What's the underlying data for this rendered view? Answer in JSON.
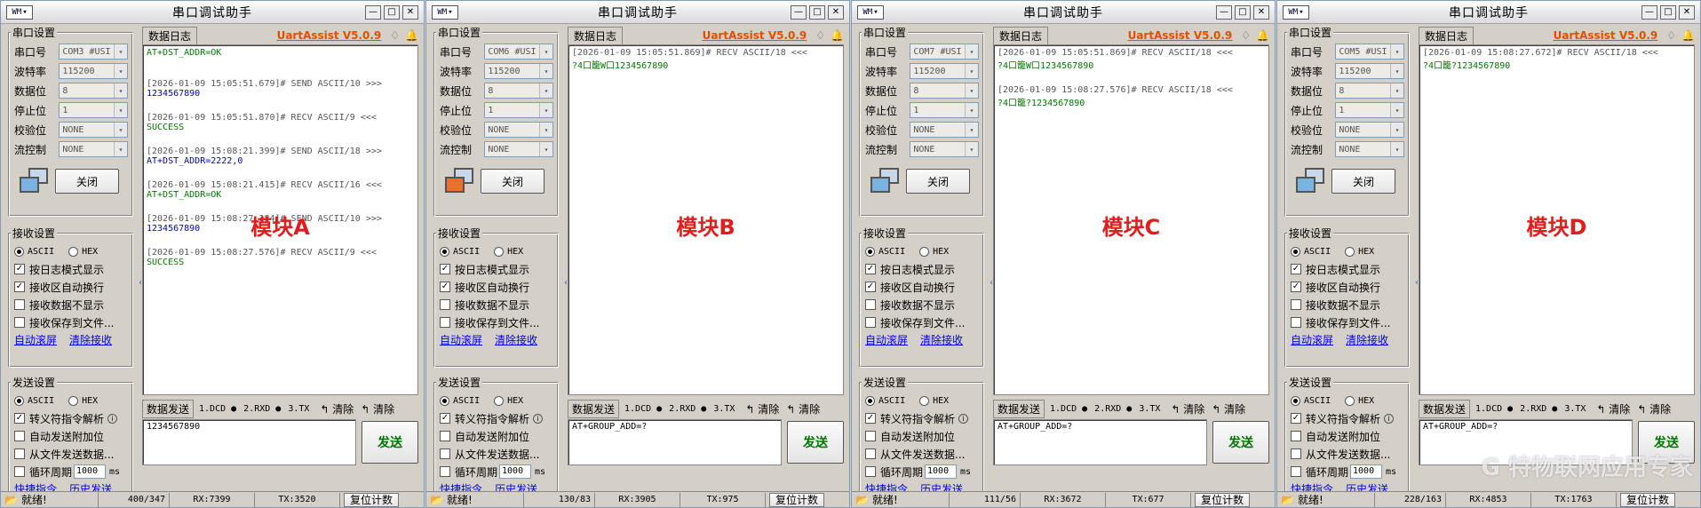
{
  "common": {
    "title": "串口调试助手",
    "brand": "UartAssist V5.0.9",
    "app_icon": "WM",
    "min_label": "—",
    "max_label": "□",
    "close_label": "✕",
    "port_group": "串口设置",
    "port_label": "串口号",
    "baud_label": "波特率",
    "databits_label": "数据位",
    "stopbits_label": "停止位",
    "parity_label": "校验位",
    "flow_label": "流控制",
    "baud_value": "115200",
    "databits_value": "8",
    "stopbits_value": "1",
    "parity_value": "NONE",
    "flow_value": "NONE",
    "close_button": "关闭",
    "recv_group": "接收设置",
    "ascii": "ASCII",
    "hex": "HEX",
    "recv_opt_log": "按日志模式显示",
    "recv_opt_wrap": "接收区自动换行",
    "recv_opt_hide": "接收数据不显示",
    "recv_opt_save": "接收保存到文件...",
    "auto_scroll": "自动滚屏",
    "clear_recv": "清除接收",
    "send_group": "发送设置",
    "send_opt_escape": "转义符指令解析",
    "send_opt_append": "自动发送附加位",
    "send_opt_file": "从文件发送数据...",
    "send_opt_cycle": "循环周期",
    "cycle_value": "1000",
    "cycle_unit": "ms",
    "shortcut": "快捷指令",
    "history": "历史发送",
    "log_tab": "数据日志",
    "send_tab": "数据发送",
    "dcd": "1.DCD ●",
    "rxd": "2.RXD ●",
    "tx_opt": "3.TX",
    "clear1": "↰ 清除",
    "clear2": "↰ 清除",
    "send_button": "发送",
    "ready": "就绪!",
    "reset_count": "复位计数",
    "gem_icon": "♢",
    "bell_icon": "🔔",
    "arrow_down": "▾",
    "collapse_icon": "‹",
    "check_mark": "✓",
    "info_icon": "i"
  },
  "windows": [
    {
      "port_value": "COM3 #USI",
      "module_label": "模块A",
      "icon_color": "blue",
      "log": [
        {
          "ts": "",
          "line": "AT+DST_ADDR=OK",
          "kind": "recv"
        },
        {
          "ts": "[2026-01-09 15:05:51.679]# SEND ASCII/10 >>>",
          "line": "1234567890",
          "kind": "send"
        },
        {
          "ts": "[2026-01-09 15:05:51.870]# RECV ASCII/9 <<<",
          "line": "SUCCESS",
          "kind": "recv"
        },
        {
          "ts": "[2026-01-09 15:08:21.399]# SEND ASCII/18 >>>",
          "line": "AT+DST_ADDR=2222,0",
          "kind": "send"
        },
        {
          "ts": "[2026-01-09 15:08:21.415]# RECV ASCII/16 <<<",
          "line": "AT+DST_ADDR=OK",
          "kind": "recv"
        },
        {
          "ts": "[2026-01-09 15:08:27.384]# SEND ASCII/10 >>>",
          "line": "1234567890",
          "kind": "send"
        },
        {
          "ts": "[2026-01-09 15:08:27.576]# RECV ASCII/9 <<<",
          "line": "SUCCESS",
          "kind": "recv"
        }
      ],
      "send_text": "1234567890",
      "count": "400/347",
      "rx": "RX:7399",
      "tx": "TX:3520"
    },
    {
      "port_value": "COM6 #USI",
      "module_label": "模块B",
      "icon_color": "orange",
      "log": [
        {
          "ts": "[2026-01-09 15:05:51.869]# RECV ASCII/18 <<<",
          "line": "?4口籠W口1234567890",
          "kind": "recv"
        }
      ],
      "send_text": "AT+GROUP_ADD=?",
      "count": "130/83",
      "rx": "RX:3905",
      "tx": "TX:975"
    },
    {
      "port_value": "COM7 #USI",
      "module_label": "模块C",
      "icon_color": "blue",
      "log": [
        {
          "ts": "[2026-01-09 15:05:51.869]# RECV ASCII/18 <<<",
          "line": "?4口籠W口1234567890",
          "kind": "recv"
        },
        {
          "ts": "[2026-01-09 15:08:27.576]# RECV ASCII/18 <<<",
          "line": "?4口籠?1234567890",
          "kind": "recv"
        }
      ],
      "send_text": "AT+GROUP_ADD=?",
      "count": "111/56",
      "rx": "RX:3672",
      "tx": "TX:677"
    },
    {
      "port_value": "COM5 #USI",
      "module_label": "模块D",
      "icon_color": "blue",
      "log": [
        {
          "ts": "[2026-01-09 15:08:27.672]# RECV ASCII/18 <<<",
          "line": "?4口籠?1234567890",
          "kind": "recv"
        }
      ],
      "send_text": "AT+GROUP_ADD=?",
      "count": "228/163",
      "rx": "RX:4853",
      "tx": "TX:1763",
      "watermark": "G 特物联网应用专家"
    }
  ]
}
